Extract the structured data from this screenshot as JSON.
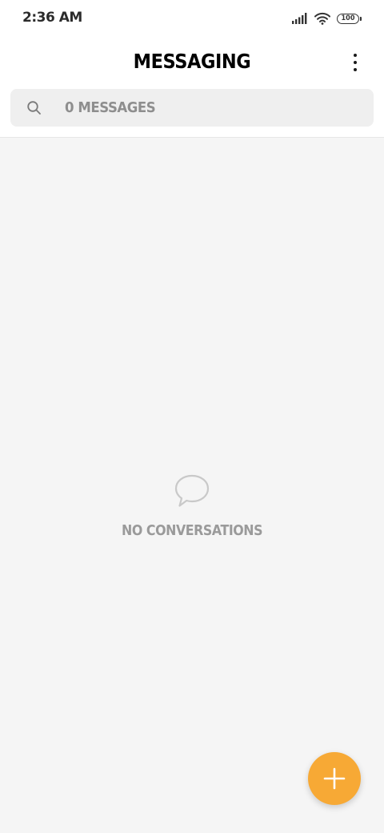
{
  "status_bar": {
    "time": "2:36 AM",
    "battery_level": "100",
    "icons": [
      "signal-icon",
      "wifi-icon",
      "battery-icon"
    ]
  },
  "header": {
    "title": "MESSAGING",
    "menu_icon": "more-vertical-icon"
  },
  "search": {
    "placeholder": "0 MESSAGES",
    "icon": "search-icon"
  },
  "empty_state": {
    "icon": "chat-bubble-icon",
    "label": "NO CONVERSATIONS"
  },
  "fab": {
    "icon": "plus-icon",
    "color": "#f7a935"
  },
  "colors": {
    "accent": "#f7a935",
    "background": "#f5f5f5",
    "search_background": "#efefef"
  }
}
